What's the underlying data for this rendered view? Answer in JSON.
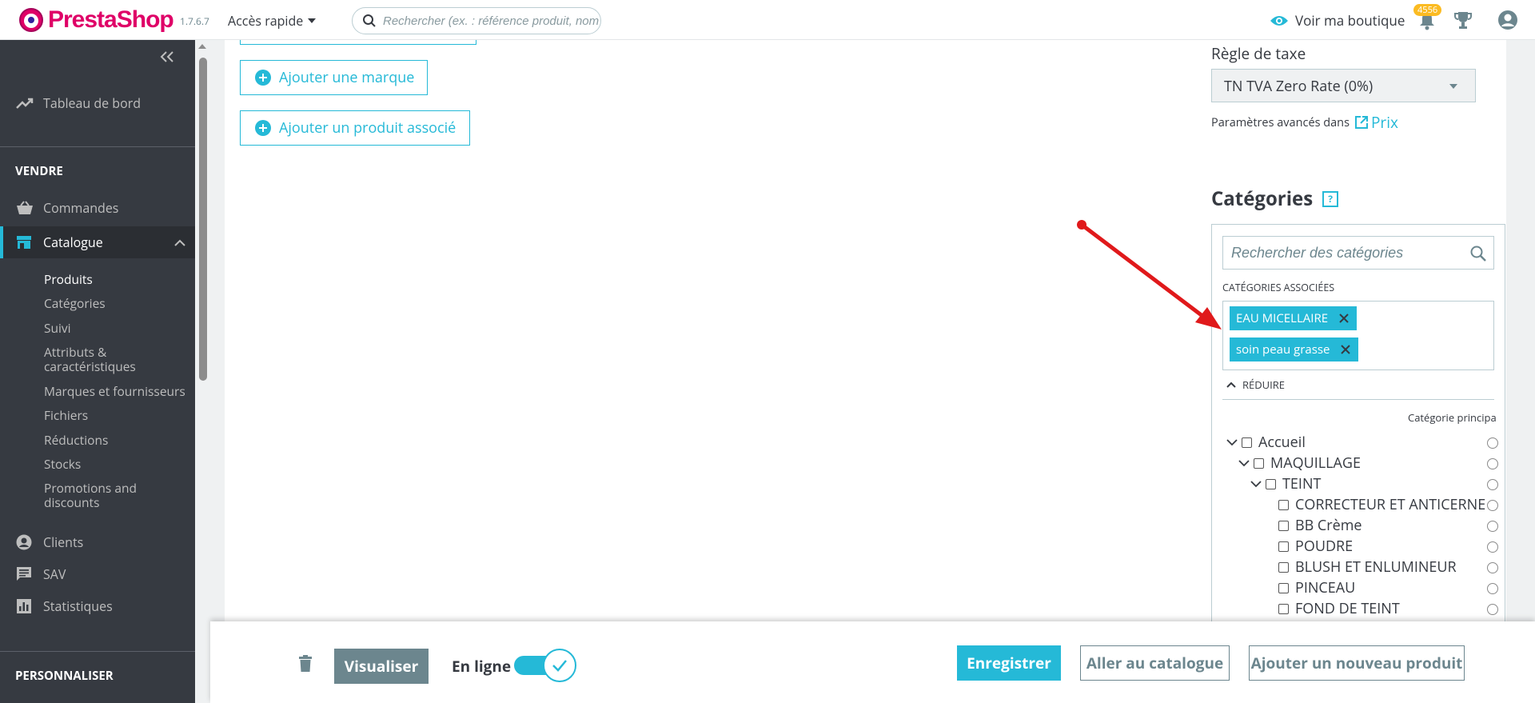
{
  "header": {
    "brand": "PrestaShop",
    "version": "1.7.6.7",
    "quick_access": "Accès rapide",
    "search_placeholder": "Rechercher (ex. : référence produit, nom",
    "view_shop": "Voir ma boutique",
    "notifications_count": "4556",
    "icons": [
      "eye-icon",
      "bell-icon",
      "trophy-icon",
      "user-icon"
    ]
  },
  "sidebar": {
    "dashboard": "Tableau de bord",
    "section_sell": "VENDRE",
    "orders": "Commandes",
    "catalog": "Catalogue",
    "catalog_items": [
      "Produits",
      "Catégories",
      "Suivi",
      "Attributs & caractéristiques",
      "Marques et fournisseurs",
      "Fichiers",
      "Réductions",
      "Stocks",
      "Promotions and discounts"
    ],
    "clients": "Clients",
    "sav": "SAV",
    "stats": "Statistiques",
    "section_customize": "PERSONNALISER"
  },
  "main": {
    "add_brand": "Ajouter une marque",
    "add_related": "Ajouter un produit associé",
    "tax_rule_title": "Règle de taxe",
    "tax_rule_value": "TN TVA Zero Rate (0%)",
    "advanced_params": "Paramètres avancés dans",
    "price_link": "Prix",
    "categories_title": "Catégories",
    "help_mark": "?",
    "categories_search_placeholder": "Rechercher des catégories",
    "associated_label": "Catégories associées",
    "tags": [
      "EAU MICELLAIRE",
      "soin peau grasse"
    ],
    "reduce": "Réduire",
    "main_category_label": "Catégorie principa",
    "tree": [
      {
        "label": "Accueil",
        "level": 0,
        "expanded": true
      },
      {
        "label": "MAQUILLAGE",
        "level": 1,
        "expanded": true
      },
      {
        "label": "TEINT",
        "level": 2,
        "expanded": true
      },
      {
        "label": "CORRECTEUR ET ANTICERNE",
        "level": 3
      },
      {
        "label": "BB Crème",
        "level": 3
      },
      {
        "label": "POUDRE",
        "level": 3
      },
      {
        "label": "BLUSH ET ENLUMINEUR",
        "level": 3
      },
      {
        "label": "PINCEAU",
        "level": 3
      },
      {
        "label": "FOND DE TEINT",
        "level": 3
      }
    ]
  },
  "footer": {
    "preview": "Visualiser",
    "online": "En ligne",
    "online_state": true,
    "save": "Enregistrer",
    "go_catalog": "Aller au catalogue",
    "add_new": "Ajouter un nouveau produit"
  },
  "colors": {
    "accent": "#25b9d7",
    "sidebar_bg": "#363a41",
    "brand": "#df0067",
    "annotation_arrow": "#e0191b"
  }
}
